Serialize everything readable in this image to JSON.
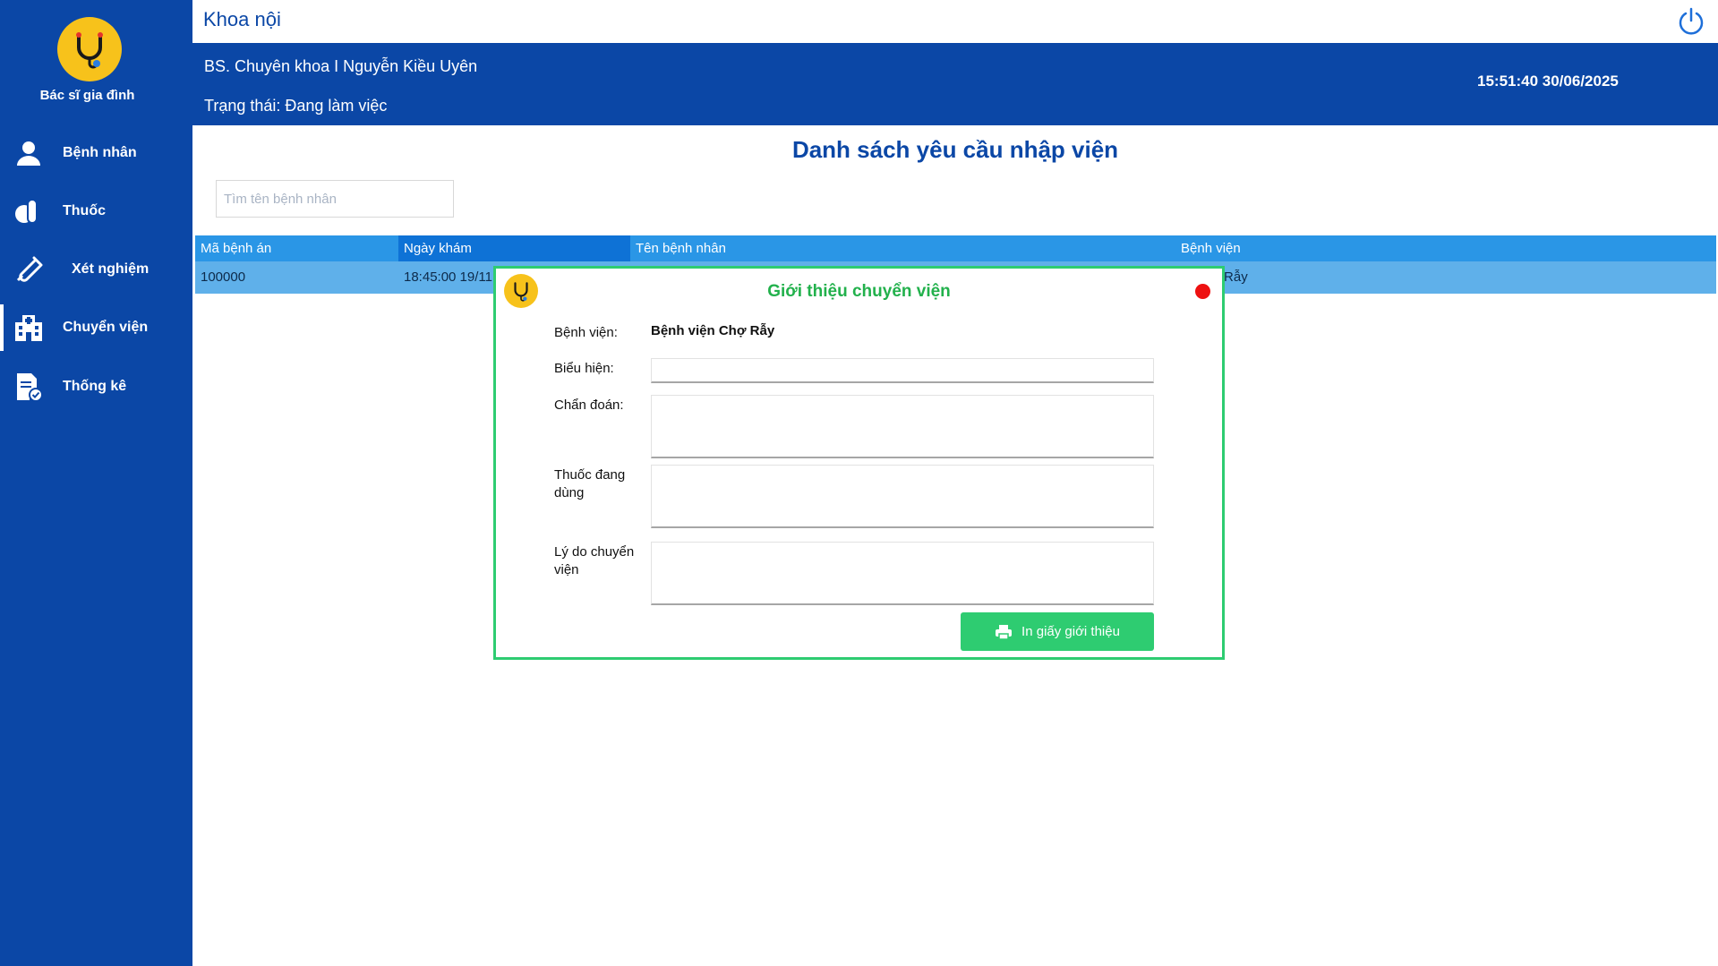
{
  "sidebar": {
    "app_name": "Bác sĩ gia đình",
    "items": [
      {
        "label": "Bệnh nhân",
        "icon": "user-icon"
      },
      {
        "label": "Thuốc",
        "icon": "pills-icon"
      },
      {
        "label": "Xét nghiệm",
        "icon": "test-tube-icon"
      },
      {
        "label": "Chuyển viện",
        "icon": "hospital-icon"
      },
      {
        "label": "Thống kê",
        "icon": "report-icon"
      }
    ],
    "active_item": "Chuyển viện"
  },
  "header": {
    "department": "Khoa nội",
    "doctor": "BS. Chuyên khoa I Nguyễn Kiều Uyên",
    "status": "Trạng thái: Đang làm việc",
    "datetime": "15:51:40 30/06/2025"
  },
  "main": {
    "title": "Danh sách yêu cầu nhập viện",
    "search_placeholder": "Tìm tên bệnh nhân",
    "table": {
      "columns": [
        "Mã bệnh án",
        "Ngày khám",
        "Tên bệnh nhân",
        "Bệnh viện"
      ],
      "rows": [
        [
          "100000",
          "18:45:00 19/11",
          "",
          "en Chợ Rẫy"
        ]
      ]
    }
  },
  "modal": {
    "title": "Giới thiệu chuyển viện",
    "hospital_label": "Bệnh viện:",
    "hospital_value": "Bệnh viện Chợ Rẫy",
    "symptom_label": "Biểu hiện:",
    "diagnosis_label": "Chẩn đoán:",
    "medication_label": "Thuốc đang dùng",
    "reason_label": "Lý do chuyển viện",
    "print_button": "In giấy giới thiệu"
  },
  "colors": {
    "primary": "#0b47a6",
    "header_blue": "#2a96e6",
    "row_selected": "#5fb0ea",
    "success": "#2ecc71",
    "logo": "#f7c21b",
    "close": "#ee1111"
  }
}
